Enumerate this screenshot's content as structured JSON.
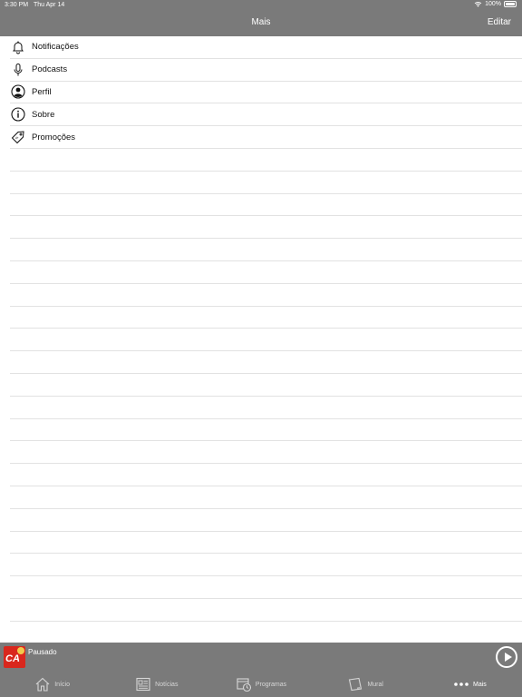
{
  "status_bar": {
    "time": "3:30 PM",
    "date": "Thu Apr 14",
    "battery": "100%"
  },
  "nav": {
    "title": "Mais",
    "edit_label": "Editar"
  },
  "menu": [
    {
      "label": "Notificações",
      "icon": "bell-icon"
    },
    {
      "label": "Podcasts",
      "icon": "microphone-icon"
    },
    {
      "label": "Perfil",
      "icon": "user-icon"
    },
    {
      "label": "Sobre",
      "icon": "info-icon"
    },
    {
      "label": "Promoções",
      "icon": "tag-icon"
    }
  ],
  "player": {
    "status": "Pausado",
    "logo_text": "CA"
  },
  "tabs": [
    {
      "label": "Início",
      "icon": "home-icon"
    },
    {
      "label": "Notícias",
      "icon": "newspaper-icon"
    },
    {
      "label": "Programas",
      "icon": "calendar-clock-icon"
    },
    {
      "label": "Mural",
      "icon": "note-icon"
    },
    {
      "label": "Mais",
      "icon": "more-dots-icon",
      "active": true
    }
  ]
}
